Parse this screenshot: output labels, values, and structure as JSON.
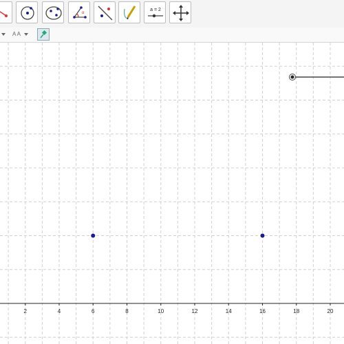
{
  "toolbar": {
    "tools": [
      {
        "name": "segment-tool-icon"
      },
      {
        "name": "circle-tool-icon"
      },
      {
        "name": "conic-tool-icon"
      },
      {
        "name": "angle-tool-icon"
      },
      {
        "name": "reflect-tool-icon"
      },
      {
        "name": "pen-tool-icon"
      },
      {
        "name": "slider-tool-icon",
        "label": "a = 2"
      },
      {
        "name": "move-view-tool-icon"
      }
    ]
  },
  "stylebar": {
    "text_size_label": "A A"
  },
  "graphics": {
    "x_axis_ticks": [
      "2",
      "4",
      "6",
      "8",
      "10",
      "12",
      "14",
      "16",
      "18",
      "20"
    ],
    "points": [
      {
        "x": 6,
        "y": 4
      },
      {
        "x": 16,
        "y": 4
      }
    ],
    "point_color": "#1a1a99"
  }
}
